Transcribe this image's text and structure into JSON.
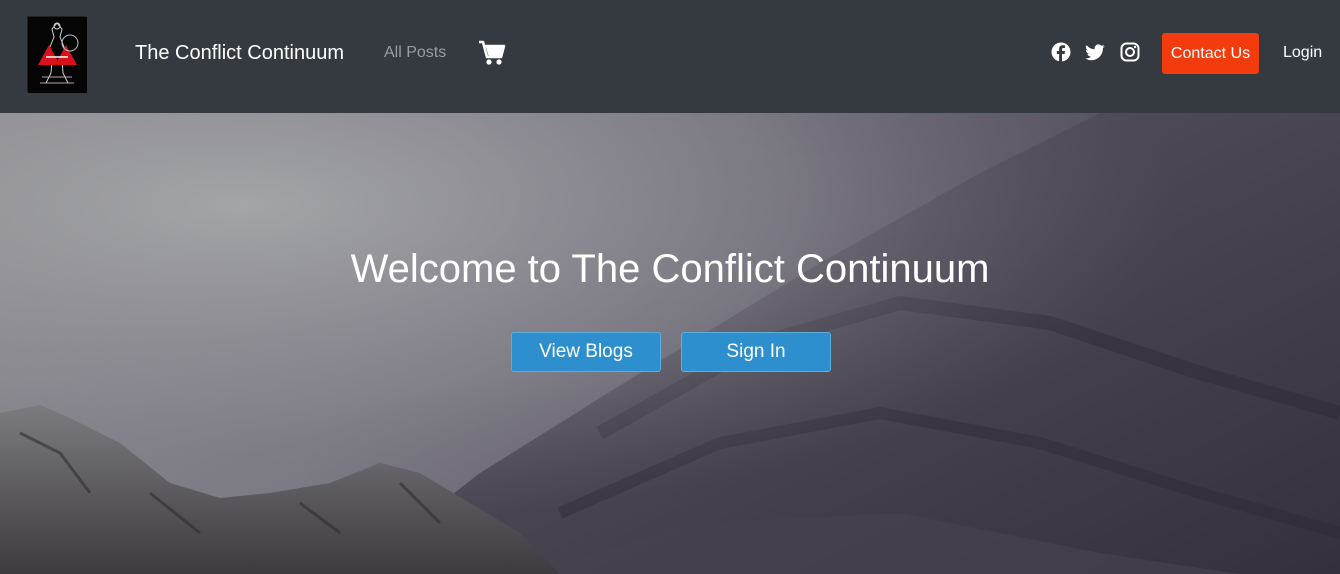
{
  "navbar": {
    "brand": "The Conflict Continuum",
    "nav_link": "All Posts",
    "cart_icon": "shopping-cart-icon",
    "social_icons": [
      "facebook-icon",
      "twitter-icon",
      "instagram-icon"
    ],
    "contact_label": "Contact Us",
    "login_label": "Login"
  },
  "hero": {
    "title": "Welcome to The Conflict Continuum",
    "view_blogs_label": "View Blogs",
    "sign_in_label": "Sign In"
  },
  "colors": {
    "navbar_bg": "#343a40",
    "contact_button": "#f23c0d",
    "hero_button": "#2e8fcf"
  }
}
